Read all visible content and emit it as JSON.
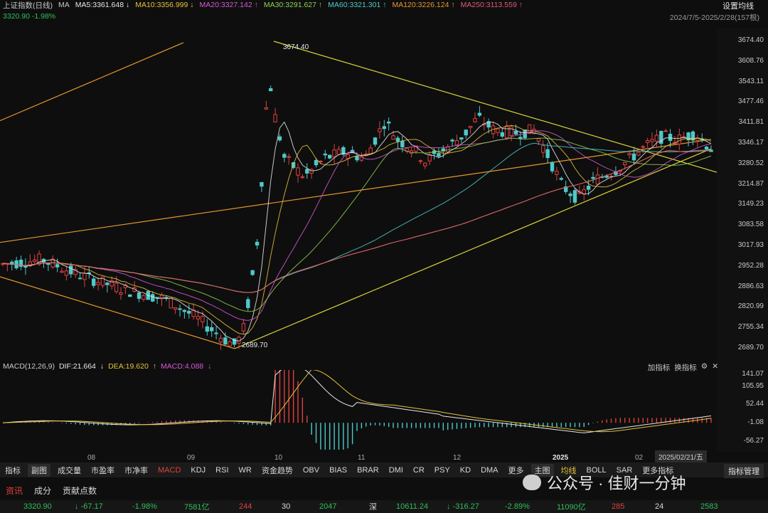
{
  "header": {
    "index_name": "上证指数(日线)",
    "ma_label": "MA",
    "ma": [
      {
        "label": "MA5:3361.648",
        "arrow": "↓",
        "color": "#e8e8e8"
      },
      {
        "label": "MA10:3356.999",
        "arrow": "↓",
        "color": "#e6c23a"
      },
      {
        "label": "MA20:3327.142",
        "arrow": "↑",
        "color": "#d45bd4"
      },
      {
        "label": "MA30:3291.627",
        "arrow": "↑",
        "color": "#8fd14f"
      },
      {
        "label": "MA60:3321.301",
        "arrow": "↑",
        "color": "#4fc9c9"
      },
      {
        "label": "MA120:3226.124",
        "arrow": "↑",
        "color": "#e8962f"
      },
      {
        "label": "MA250:3113.559",
        "arrow": "↑",
        "color": "#e05a7a"
      }
    ],
    "settings_label": "设置均线",
    "price_change": "3320.90 -1.98%",
    "date_range": "2024/7/5-2025/2/28(157根)"
  },
  "chart_data": {
    "type": "candlestick",
    "price_axis": {
      "ticks": [
        "3674.40",
        "3608.76",
        "3543.11",
        "3477.46",
        "3411.81",
        "3346.17",
        "3280.52",
        "3214.87",
        "3149.23",
        "3083.58",
        "3017.93",
        "2952.28",
        "2886.63",
        "2820.99",
        "2755.34",
        "2689.70"
      ],
      "range": [
        2689.7,
        3674.4
      ]
    },
    "annotations": {
      "high": "3674.40",
      "low": "2689.70"
    },
    "x_ticks": [
      "08",
      "09",
      "10",
      "11",
      "12",
      "2025",
      "02"
    ],
    "current_date": "2025/02/21/五",
    "macd": {
      "label": "MACD(12,26,9)",
      "dif": "DIF:21.664",
      "dea": "DEA:19.620",
      "macd": "MACD:4.088",
      "ticks": [
        "141.07",
        "105.95",
        "52.44",
        "-1.08",
        "-56.27"
      ],
      "right_labels": [
        "加指标",
        "换指标"
      ]
    }
  },
  "tabs": [
    "指标",
    "副图",
    "成交量",
    "市盈率",
    "市净率",
    "MACD",
    "KDJ",
    "RSI",
    "WR",
    "资金趋势",
    "OBV",
    "BIAS",
    "BRAR",
    "DMI",
    "CR",
    "PSY",
    "KD",
    "DMA",
    "更多",
    "主图",
    "均线",
    "BOLL",
    "SAR",
    "更多指标"
  ],
  "indicator_mgmt": "指标管理",
  "bottom_tabs": [
    "资讯",
    "成分",
    "贡献点数"
  ],
  "watermark": "公众号 · 佳财一分钟",
  "ticker": {
    "sh_price": "3320.90",
    "sh_chg": "-67.17",
    "sh_pct": "-1.98%",
    "sh_amount": "7581亿",
    "sh_up": "244",
    "sh_flat": "30",
    "sh_down": "2047",
    "sz_label": "深",
    "sz_price": "10611.24",
    "sz_chg": "-316.27",
    "sz_pct": "-2.89%",
    "sz_amount": "11090亿",
    "sz_up": "285",
    "sz_flat": "24",
    "sz_down": "2583"
  }
}
